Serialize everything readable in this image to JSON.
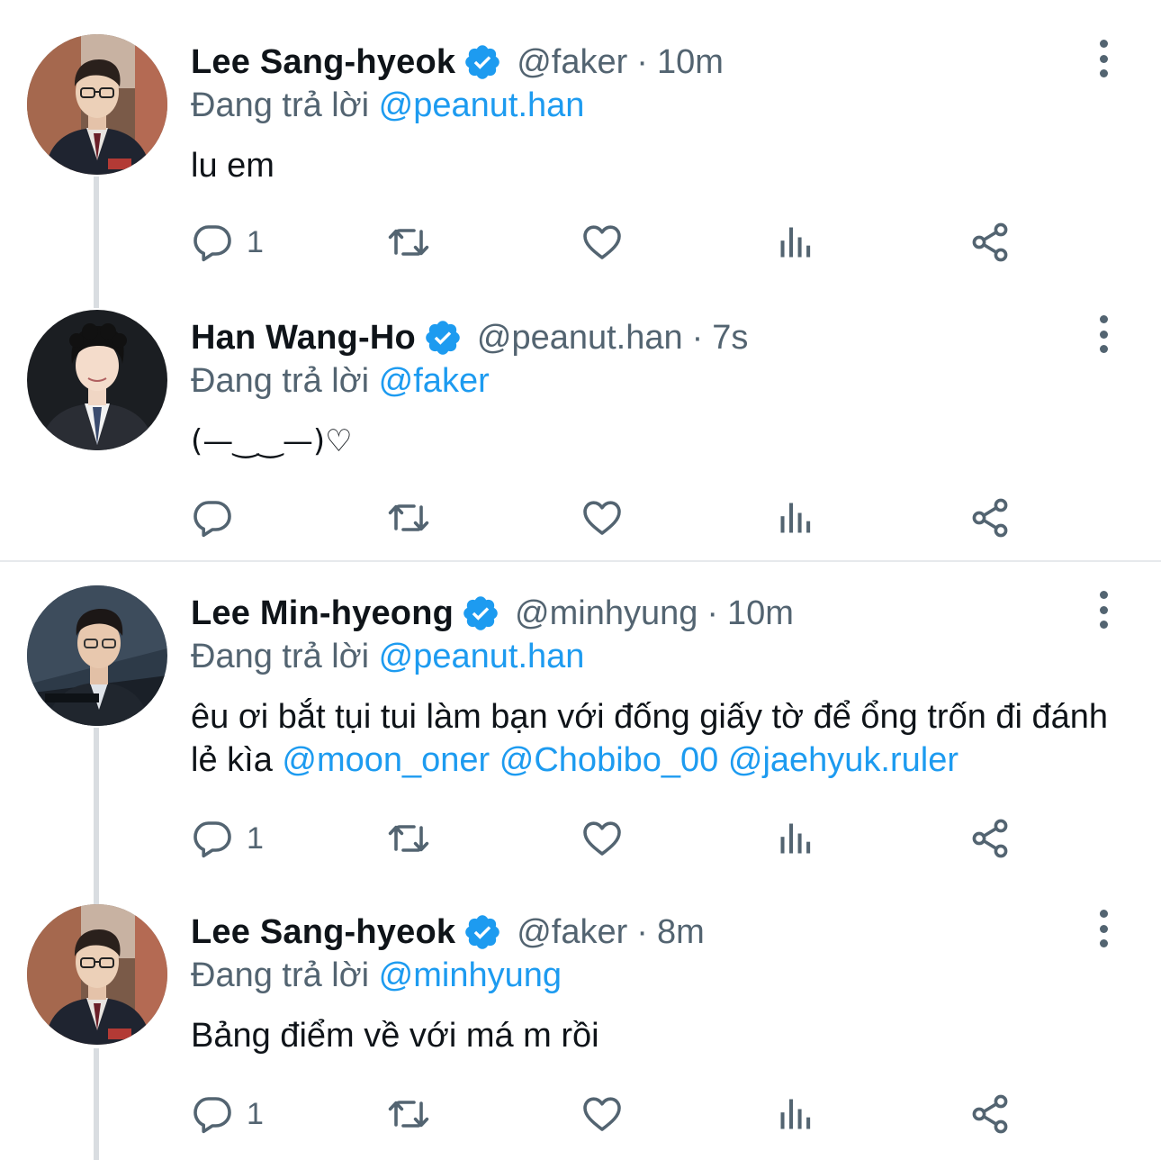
{
  "colors": {
    "link": "#1d9bf0",
    "secondary_text": "#536471",
    "primary_text": "#0f1419",
    "verified_badge": "#1d9bf0",
    "thread_line": "#d9dde1"
  },
  "tweets": [
    {
      "name": "Lee Sang-hyeok",
      "handle": "@faker",
      "separator": "·",
      "time": "10m",
      "replying_prefix": "Đang trả lời",
      "replying_to": "@peanut.han",
      "text": "lu em",
      "reply_count": "1",
      "avatar_icon": "avatar-photo-lee-sang-hyeok"
    },
    {
      "name": "Han Wang-Ho",
      "handle": "@peanut.han",
      "separator": "·",
      "time": "7s",
      "replying_prefix": "Đang trả lời",
      "replying_to": "@faker",
      "text": "(—‿‿—)♡",
      "reply_count": "",
      "avatar_icon": "avatar-photo-han-wang-ho"
    },
    {
      "name": "Lee Min-hyeong",
      "handle": "@minhyung",
      "separator": "·",
      "time": "10m",
      "replying_prefix": "Đang trả lời",
      "replying_to": "@peanut.han",
      "text_plain": "êu ơi bắt tụi tui làm bạn với đống giấy tờ để ổng trốn đi đánh lẻ kìa",
      "mentions": [
        "@moon_oner",
        "@Chobibo_00",
        "@jaehyuk.ruler"
      ],
      "reply_count": "1",
      "avatar_icon": "avatar-photo-lee-min-hyeong"
    },
    {
      "name": "Lee Sang-hyeok",
      "handle": "@faker",
      "separator": "·",
      "time": "8m",
      "replying_prefix": "Đang trả lời",
      "replying_to": "@minhyung",
      "text": "Bảng điểm về với má m rồi",
      "reply_count": "1",
      "avatar_icon": "avatar-photo-lee-sang-hyeok"
    }
  ],
  "action_icons": [
    "reply-icon",
    "retweet-icon",
    "like-icon",
    "views-icon",
    "share-icon"
  ]
}
